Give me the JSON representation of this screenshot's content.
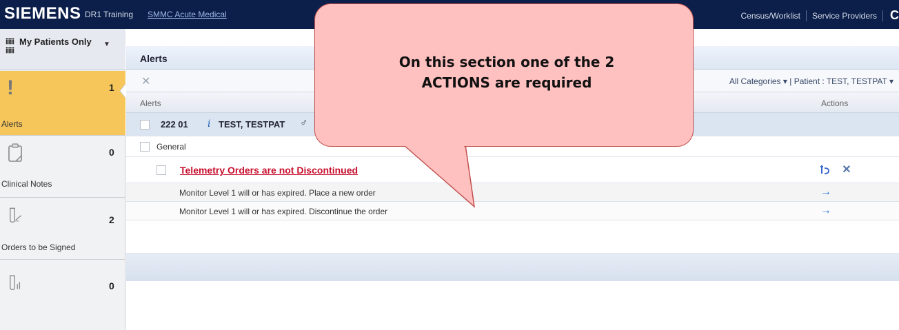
{
  "header": {
    "brand": "SIEMENS",
    "environment": "DR1 Training",
    "location": "SMMC Acute Medical",
    "links": [
      "Census/Worklist",
      "Service Providers"
    ],
    "overflow_char": "C"
  },
  "sidebar": {
    "filter_label": "My Patients Only",
    "filter_icon": "grid-icon",
    "items": [
      {
        "label": "Alerts",
        "count": "1",
        "icon": "exclamation-icon",
        "active": true
      },
      {
        "label": "Clinical Notes",
        "count": "0",
        "icon": "clipboard-icon",
        "active": false
      },
      {
        "label": "Orders to be Signed",
        "count": "2",
        "icon": "test-tube-sign-icon",
        "active": false
      },
      {
        "label": "",
        "count": "0",
        "icon": "test-tube-icon",
        "active": false
      }
    ]
  },
  "main": {
    "title": "Alerts",
    "toolbar": {
      "dismiss_icon": "close-icon",
      "categories_filter": "All Categories ▾",
      "patient_filter": "Patient : TEST, TESTPAT ▾"
    },
    "columns": [
      "Alerts",
      "Actions"
    ],
    "patient_row": {
      "bed": "222 01",
      "name": "TEST, TESTPAT",
      "sex_symbol": "♂"
    },
    "category": "General",
    "alert": {
      "title": "Telemetry Orders are not Discontinued",
      "actions": [
        "add-order-icon",
        "close-icon"
      ]
    },
    "action_rows": [
      {
        "text": "Monitor Level 1 will or has expired. Place a new order"
      },
      {
        "text": "Monitor Level 1 will or has expired. Discontinue the order"
      }
    ]
  },
  "callout": {
    "line1": "On this section one of the 2",
    "line2": "ACTIONS are required",
    "color": "#ffc0c0",
    "border": "#c0504d"
  },
  "colors": {
    "topbar": "#0b1f4a",
    "active_item": "#f7c65a",
    "alert_text": "#c8102e"
  }
}
